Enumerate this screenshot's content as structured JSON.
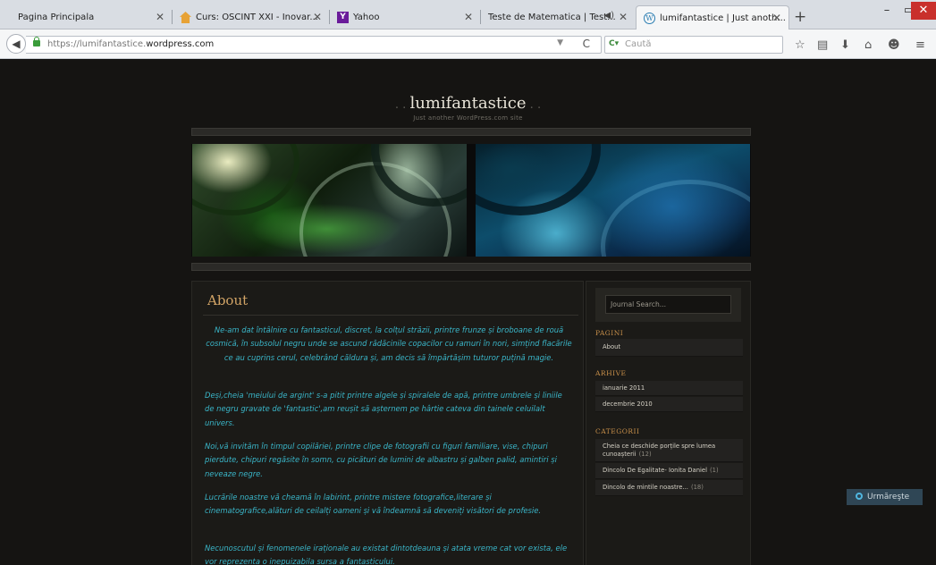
{
  "browser": {
    "tabs": [
      {
        "label": "Pagina Principala",
        "icon": "none"
      },
      {
        "label": "Curs: OSCINT XXI - Inovar...",
        "icon": "course-icon"
      },
      {
        "label": "Yahoo",
        "icon": "yahoo-icon"
      },
      {
        "label": "Teste de Matematica | Test...",
        "icon": "speaker-icon"
      },
      {
        "label": "lumifantastice | Just anoth...",
        "icon": "wordpress-icon",
        "active": true
      }
    ],
    "url_prefix": "https://lumifantastice.",
    "url_domain": "wordpress.com",
    "search_placeholder": "Caută",
    "new_tab": "+",
    "window_controls": {
      "minimize": "–",
      "maximize": "▭",
      "close": "✕"
    }
  },
  "site": {
    "title": "lumifantastice",
    "tagline": "Just another WordPress.com site"
  },
  "post": {
    "title": "About",
    "paragraphs": [
      "Ne-am dat întâlnire cu fantasticul, discret, la colțul străzii, printre frunze și broboane de rouă cosmică, în subsolul negru unde se ascund rădăcinile copacilor cu ramuri în nori, simțind flacările ce au cuprins cerul, celebrând căldura și, am decis să împărtășim tuturor puțină magie.",
      "Deși,cheia 'meiului de argint' s-a pitit printre algele și spiralele de apă, printre umbrele și liniile de negru gravate de 'fantastic',am reușit să așternem pe hârtie cateva din tainele celuilalt univers.",
      "Noi,vă invităm în timpul copilăriei, printre clipe de fotografii cu figuri familiare, vise, chipuri pierdute, chipuri regăsite în somn, cu picături de lumini de albastru și galben palid, amintiri și neveaze negre.",
      "Lucrările noastre vă cheamă în labirint, printre mistere fotografice,literare și cinematografice,alături de ceilalți oameni și vă îndeamnă să deveniți visători de profesie.",
      "Necunoscutul și fenomenele iraționale au existat dintotdeauna și atata vreme cat vor exista, ele vor reprezenta o inepuizabila sursa a fantasticului."
    ]
  },
  "sidebar": {
    "search_placeholder": "Journal Search...",
    "pages_heading": "Pagini",
    "pages": [
      "About"
    ],
    "archive_heading": "Arhive",
    "archives": [
      "ianuarie 2011",
      "decembrie 2010"
    ],
    "categories_heading": "Categorii",
    "categories": [
      {
        "name": "Cheia ce deschide porțile spre lumea cunoașterii",
        "count": "(12)"
      },
      {
        "name": "Dincolo De Egalitate- Ionita Daniel",
        "count": "(1)"
      },
      {
        "name": "Dincolo de mintile noastre...",
        "count": "(18)"
      }
    ]
  },
  "follow_button": "Urmăreşte"
}
